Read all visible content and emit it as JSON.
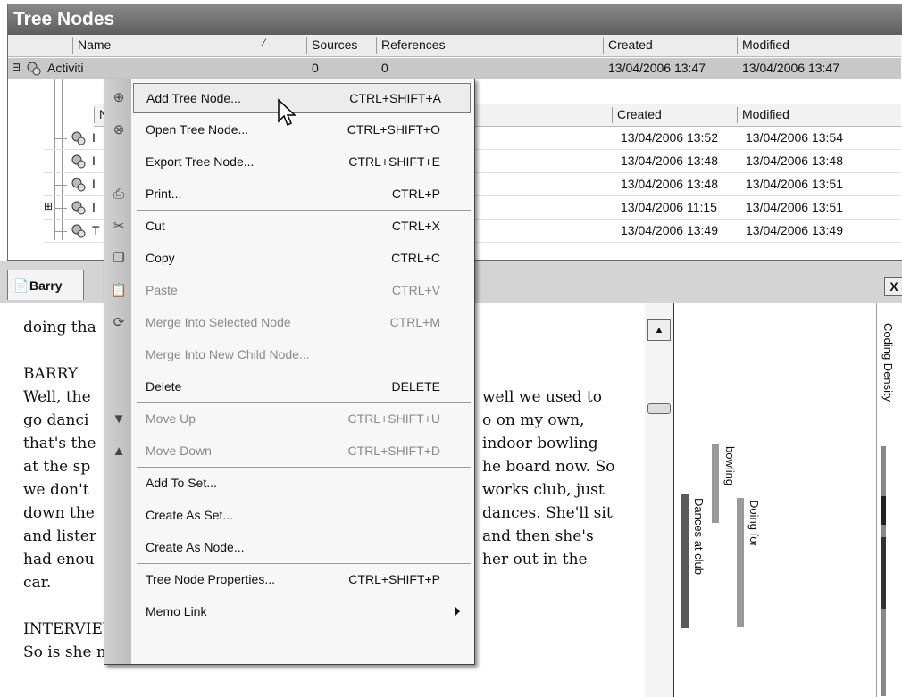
{
  "tree_panel": {
    "title": "Tree Nodes",
    "columns": {
      "name": "Name",
      "sources": "Sources",
      "references": "References",
      "created": "Created",
      "modified": "Modified"
    },
    "top_row": {
      "name": "Activiti",
      "sources": "0",
      "references": "0",
      "created": "13/04/2006 13:47",
      "modified": "13/04/2006 13:47"
    },
    "sub_columns": {
      "name": "N",
      "created": "Created",
      "modified": "Modified"
    },
    "child_rows": [
      {
        "name": "I",
        "created": "13/04/2006 13:52",
        "modified": "13/04/2006 13:54"
      },
      {
        "name": "I",
        "created": "13/04/2006 13:48",
        "modified": "13/04/2006 13:48"
      },
      {
        "name": "I",
        "created": "13/04/2006 13:48",
        "modified": "13/04/2006 13:51"
      },
      {
        "name": "I",
        "created": "13/04/2006 11:15",
        "modified": "13/04/2006 13:51"
      },
      {
        "name": "T",
        "created": "13/04/2006 13:49",
        "modified": "13/04/2006 13:49"
      }
    ]
  },
  "document": {
    "tab_label": "Barry",
    "close_label": "X",
    "lines": [
      "doing tha",
      "",
      "BARRY",
      "Well, the",
      "go danci",
      "that's the",
      "at the sp",
      "we don't",
      "down the",
      "and lister",
      "had enou",
      "car.",
      "",
      "INTERVIEWER",
      "So is she mobile enough to get up and down the steps?"
    ],
    "right_lines": [
      "well we used to",
      "o on my own,",
      "indoor bowling",
      "he board now. So",
      "works club, just",
      "dances. She'll sit",
      "and then she's",
      "her out in the"
    ]
  },
  "coding_density": {
    "title": "Coding Density",
    "stripes": [
      {
        "label": "bowling",
        "color": "#9a9a9a"
      },
      {
        "label": "Dances at club",
        "color": "#5a5a5a"
      },
      {
        "label": "Doing for",
        "color": "#9a9a9a"
      }
    ]
  },
  "context_menu": {
    "items": [
      {
        "label": "Add Tree Node...",
        "shortcut": "CTRL+SHIFT+A",
        "icon": "add-node-icon",
        "disabled": false,
        "highlighted": true
      },
      {
        "label": "Open Tree Node...",
        "shortcut": "CTRL+SHIFT+O",
        "icon": "open-node-icon",
        "disabled": false
      },
      {
        "label": "Export Tree Node...",
        "shortcut": "CTRL+SHIFT+E",
        "disabled": false
      },
      {
        "label": "Print...",
        "shortcut": "CTRL+P",
        "icon": "print-icon",
        "disabled": false
      },
      {
        "label": "Cut",
        "shortcut": "CTRL+X",
        "icon": "scissors-icon",
        "disabled": false
      },
      {
        "label": "Copy",
        "shortcut": "CTRL+C",
        "icon": "copy-icon",
        "disabled": false
      },
      {
        "label": "Paste",
        "shortcut": "CTRL+V",
        "icon": "paste-icon",
        "disabled": true
      },
      {
        "label": "Merge Into Selected Node",
        "shortcut": "CTRL+M",
        "icon": "merge-icon",
        "disabled": true
      },
      {
        "label": "Merge Into New Child Node...",
        "shortcut": "",
        "disabled": true
      },
      {
        "label": "Delete",
        "shortcut": "DELETE",
        "disabled": false
      },
      {
        "label": "Move Up",
        "shortcut": "CTRL+SHIFT+U",
        "icon": "move-up-icon",
        "disabled": true
      },
      {
        "label": "Move Down",
        "shortcut": "CTRL+SHIFT+D",
        "icon": "move-down-icon",
        "disabled": true
      },
      {
        "label": "Add To Set...",
        "shortcut": "",
        "disabled": false
      },
      {
        "label": "Create As Set...",
        "shortcut": "",
        "disabled": false
      },
      {
        "label": "Create As Node...",
        "shortcut": "",
        "disabled": false
      },
      {
        "label": "Tree Node Properties...",
        "shortcut": "CTRL+SHIFT+P",
        "disabled": false
      },
      {
        "label": "Memo Link",
        "shortcut": "",
        "disabled": false,
        "submenu": true
      }
    ]
  }
}
